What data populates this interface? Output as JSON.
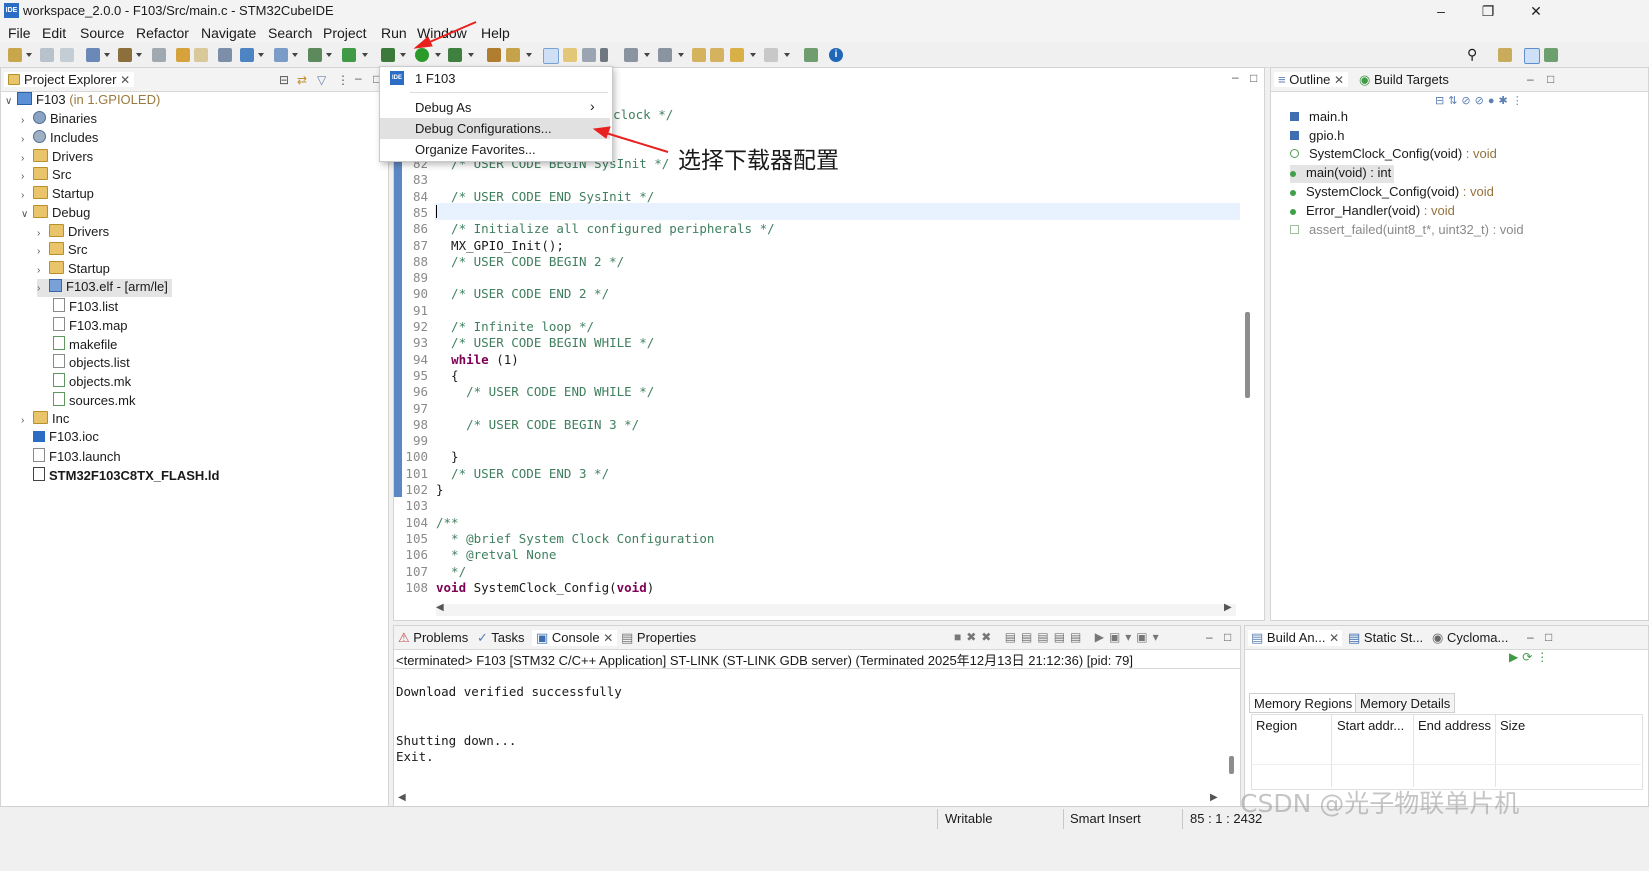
{
  "window": {
    "title": "workspace_2.0.0 - F103/Src/main.c - STM32CubeIDE",
    "app_icon_text": "IDE"
  },
  "menu": [
    "File",
    "Edit",
    "Source",
    "Refactor",
    "Navigate",
    "Search",
    "Project",
    "Run",
    "Window",
    "Help"
  ],
  "project_explorer": {
    "tab_label": "Project Explorer",
    "project": "F103",
    "project_suffix": "(in 1.GPIOLED)",
    "items": [
      {
        "label": "Binaries"
      },
      {
        "label": "Includes"
      },
      {
        "label": "Drivers"
      },
      {
        "label": "Src"
      },
      {
        "label": "Startup"
      },
      {
        "label": "Debug"
      },
      {
        "label": "Drivers"
      },
      {
        "label": "Src"
      },
      {
        "label": "Startup"
      },
      {
        "label": "F103.elf - [arm/le]"
      },
      {
        "label": "F103.list"
      },
      {
        "label": "F103.map"
      },
      {
        "label": "makefile"
      },
      {
        "label": "objects.list"
      },
      {
        "label": "objects.mk"
      },
      {
        "label": "sources.mk"
      },
      {
        "label": "Inc"
      },
      {
        "label": "F103.ioc"
      },
      {
        "label": "F103.launch"
      },
      {
        "label": "STM32F103C8TX_FLASH.ld"
      }
    ]
  },
  "popup_menu": {
    "recent": "1 F103",
    "recent_icon": "IDE",
    "items": [
      "Debug As",
      "Debug Configurations...",
      "Organize Favorites..."
    ]
  },
  "annotation": {
    "text": "选择下载器配置",
    "color": "#e8211f"
  },
  "editor": {
    "partial_top": "m clock */",
    "lines": [
      {
        "n": "82",
        "t": "  /* USER CODE BEGIN SysInit */"
      },
      {
        "n": "83",
        "t": ""
      },
      {
        "n": "84",
        "t": "  /* USER CODE END SysInit */"
      },
      {
        "n": "85",
        "t": ""
      },
      {
        "n": "86",
        "t": "  /* Initialize all configured peripherals */"
      },
      {
        "n": "87",
        "t": "  MX_GPIO_Init();"
      },
      {
        "n": "88",
        "t": "  /* USER CODE BEGIN 2 */"
      },
      {
        "n": "89",
        "t": ""
      },
      {
        "n": "90",
        "t": "  /* USER CODE END 2 */"
      },
      {
        "n": "91",
        "t": ""
      },
      {
        "n": "92",
        "t": "  /* Infinite loop */"
      },
      {
        "n": "93",
        "t": "  /* USER CODE BEGIN WHILE */"
      },
      {
        "n": "94",
        "t": "  while (1)"
      },
      {
        "n": "95",
        "t": "  {"
      },
      {
        "n": "96",
        "t": "    /* USER CODE END WHILE */"
      },
      {
        "n": "97",
        "t": ""
      },
      {
        "n": "98",
        "t": "    /* USER CODE BEGIN 3 */"
      },
      {
        "n": "99",
        "t": ""
      },
      {
        "n": "100",
        "t": "  }"
      },
      {
        "n": "101",
        "t": "  /* USER CODE END 3 */"
      },
      {
        "n": "102",
        "t": "}"
      },
      {
        "n": "103",
        "t": ""
      },
      {
        "n": "104",
        "t": "/**"
      },
      {
        "n": "105",
        "t": "  * @brief System Clock Configuration"
      },
      {
        "n": "106",
        "t": "  * @retval None"
      },
      {
        "n": "107",
        "t": "  */"
      },
      {
        "n": "108",
        "t": "void SystemClock_Config(void)"
      }
    ]
  },
  "outline": {
    "tabs": [
      "Outline",
      "Build Targets"
    ],
    "items": [
      {
        "name": "main.h",
        "type": ""
      },
      {
        "name": "gpio.h",
        "type": ""
      },
      {
        "name": "SystemClock_Config(void)",
        "type": " : void"
      },
      {
        "name": "main(void) : int",
        "type": ""
      },
      {
        "name": "SystemClock_Config(void)",
        "type": " : void"
      },
      {
        "name": "Error_Handler(void)",
        "type": " : void"
      },
      {
        "name": "assert_failed(uint8_t*, uint32_t)",
        "type": " : void"
      }
    ]
  },
  "console": {
    "tabs": [
      "Problems",
      "Tasks",
      "Console",
      "Properties"
    ],
    "header": "<terminated> F103 [STM32 C/C++ Application] ST-LINK (ST-LINK GDB server) (Terminated 2025年12月13日 21:12:36) [pid: 79]",
    "lines": [
      "Download verified successfully",
      "",
      "",
      "Shutting down...",
      "Exit."
    ]
  },
  "build_analyzer": {
    "tabs": [
      "Build An...",
      "Static St...",
      "Cycloma..."
    ],
    "subtabs": [
      "Memory Regions",
      "Memory Details"
    ],
    "columns": [
      "Region",
      "Start addr...",
      "End address",
      "Size"
    ]
  },
  "statusbar": {
    "writable": "Writable",
    "insert_mode": "Smart Insert",
    "position": "85 : 1 : 2432"
  },
  "watermark": "CSDN @光子物联单片机"
}
